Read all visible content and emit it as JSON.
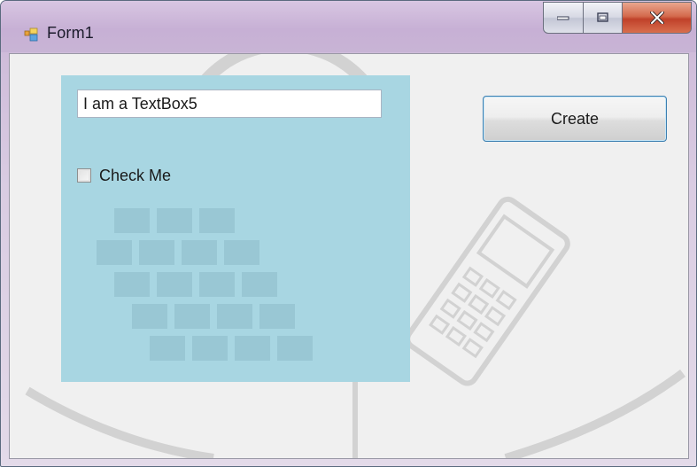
{
  "window": {
    "title": "Form1",
    "icon": "winforms-app-icon"
  },
  "caption_buttons": {
    "minimize_icon": "minimize-icon",
    "maximize_icon": "maximize-icon",
    "close_icon": "close-icon"
  },
  "panel": {
    "background_color": "#a8d6e2",
    "textbox": {
      "value": "I am a TextBox5"
    },
    "checkbox": {
      "label": "Check Me",
      "checked": false
    }
  },
  "create_button": {
    "label": "Create"
  }
}
